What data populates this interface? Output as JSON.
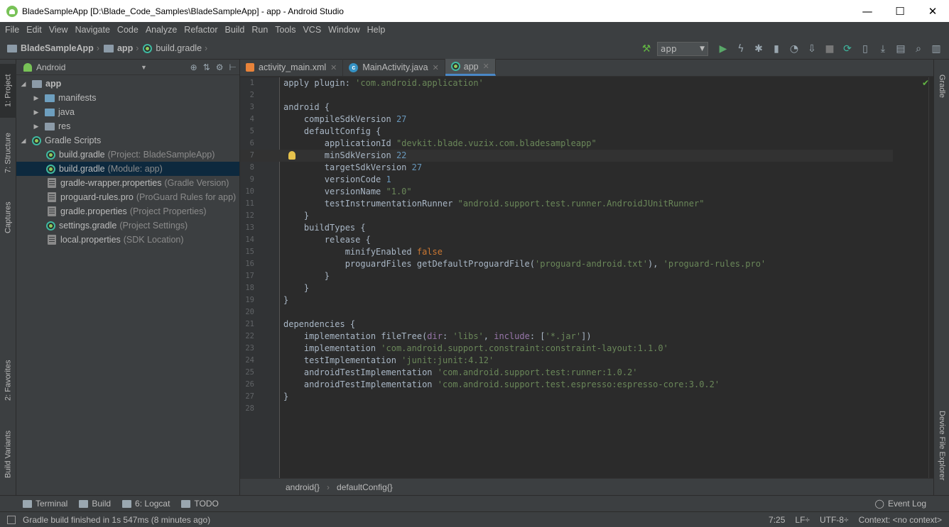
{
  "window": {
    "title": "BladeSampleApp [D:\\Blade_Code_Samples\\BladeSampleApp] - app - Android Studio",
    "minimize": "—",
    "maximize": "☐",
    "close": "✕"
  },
  "menu": [
    "File",
    "Edit",
    "View",
    "Navigate",
    "Code",
    "Analyze",
    "Refactor",
    "Build",
    "Run",
    "Tools",
    "VCS",
    "Window",
    "Help"
  ],
  "breadcrumb": {
    "project": "BladeSampleApp",
    "module": "app",
    "file": "build.gradle"
  },
  "toolbar": {
    "run_config": "app"
  },
  "left_tabs": {
    "project": "1: Project",
    "structure": "7: Structure",
    "captures": "Captures",
    "favorites": "2: Favorites",
    "build_variants": "Build Variants"
  },
  "right_tabs": {
    "gradle": "Gradle",
    "device_explorer": "Device File Explorer"
  },
  "project_panel": {
    "view": "Android",
    "tree": [
      {
        "label": "app",
        "sub": ""
      },
      {
        "label": "manifests",
        "sub": ""
      },
      {
        "label": "java",
        "sub": ""
      },
      {
        "label": "res",
        "sub": ""
      },
      {
        "label": "Gradle Scripts",
        "sub": ""
      },
      {
        "label": "build.gradle",
        "sub": "(Project: BladeSampleApp)"
      },
      {
        "label": "build.gradle",
        "sub": "(Module: app)"
      },
      {
        "label": "gradle-wrapper.properties",
        "sub": "(Gradle Version)"
      },
      {
        "label": "proguard-rules.pro",
        "sub": "(ProGuard Rules for app)"
      },
      {
        "label": "gradle.properties",
        "sub": "(Project Properties)"
      },
      {
        "label": "settings.gradle",
        "sub": "(Project Settings)"
      },
      {
        "label": "local.properties",
        "sub": "(SDK Location)"
      }
    ]
  },
  "editor": {
    "tabs": [
      {
        "label": "activity_main.xml"
      },
      {
        "label": "MainActivity.java"
      },
      {
        "label": "app"
      }
    ],
    "close_glyph": "✕",
    "lines": [
      "apply plugin: 'com.android.application'",
      "",
      "android {",
      "    compileSdkVersion 27",
      "    defaultConfig {",
      "        applicationId \"devkit.blade.vuzix.com.bladesampleapp\"",
      "        minSdkVersion 22",
      "        targetSdkVersion 27",
      "        versionCode 1",
      "        versionName \"1.0\"",
      "        testInstrumentationRunner \"android.support.test.runner.AndroidJUnitRunner\"",
      "    }",
      "    buildTypes {",
      "        release {",
      "            minifyEnabled false",
      "            proguardFiles getDefaultProguardFile('proguard-android.txt'), 'proguard-rules.pro'",
      "        }",
      "    }",
      "}",
      "",
      "dependencies {",
      "    implementation fileTree(dir: 'libs', include: ['*.jar'])",
      "    implementation 'com.android.support.constraint:constraint-layout:1.1.0'",
      "    testImplementation 'junit:junit:4.12'",
      "    androidTestImplementation 'com.android.support.test:runner:1.0.2'",
      "    androidTestImplementation 'com.android.support.test.espresso:espresso-core:3.0.2'",
      "}",
      ""
    ],
    "structure_crumbs": [
      "android{}",
      "defaultConfig{}"
    ]
  },
  "bottom_tools": {
    "terminal": "Terminal",
    "build": "Build",
    "logcat": "6: Logcat",
    "todo": "TODO",
    "event_log": "Event Log"
  },
  "status": {
    "message": "Gradle build finished in 1s 547ms (8 minutes ago)",
    "position": "7:25",
    "line_sep": "LF÷",
    "encoding": "UTF-8÷",
    "context": "Context: <no context>"
  }
}
